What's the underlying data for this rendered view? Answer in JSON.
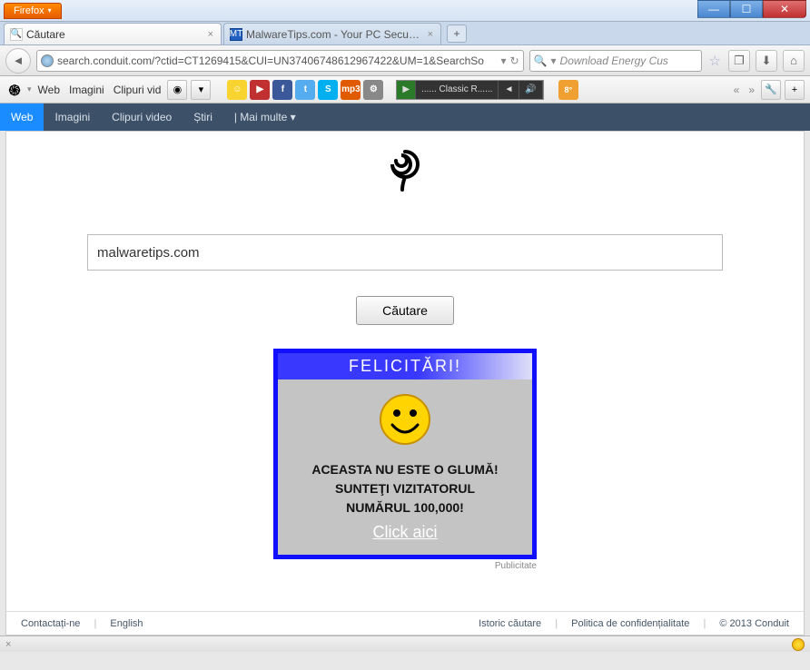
{
  "window": {
    "app_button": "Firefox",
    "controls": {
      "min": "—",
      "max": "☐",
      "close": "✕"
    }
  },
  "tabs": {
    "active": {
      "title": "Căutare",
      "favicon_glyph": "🔍"
    },
    "inactive": {
      "title": "MalwareTips.com - Your PC Security ...",
      "favicon_text": "MT"
    },
    "close_glyph": "×",
    "new_glyph": "+"
  },
  "navbar": {
    "back_glyph": "◄",
    "url": "search.conduit.com/?ctid=CT1269415&CUI=UN37406748612967422&UM=1&SearchSo",
    "reload_glyph": "↻",
    "dropdown_glyph": "▾",
    "search_placeholder": "Download Energy Cus",
    "search_icon_glyph": "🔍",
    "star_glyph": "☆",
    "bookmark_glyph": "❐",
    "download_glyph": "⬇",
    "home_glyph": "⌂"
  },
  "conduit_bar": {
    "spiral_glyph": "֍",
    "items": [
      "Web",
      "Imagini",
      "Clipuri vid"
    ],
    "more_glyph": "▾",
    "toggle_glyph": "◉",
    "icons": [
      {
        "name": "smiley-icon",
        "bg": "#f9d431",
        "txt": "☺"
      },
      {
        "name": "playvids-icon",
        "bg": "#c03030",
        "txt": "▶"
      },
      {
        "name": "facebook-icon",
        "bg": "#3b5998",
        "txt": "f"
      },
      {
        "name": "twitter-icon",
        "bg": "#55acee",
        "txt": "t"
      },
      {
        "name": "skype-icon",
        "bg": "#00aff0",
        "txt": "S"
      },
      {
        "name": "mp3-icon",
        "bg": "#e05a00",
        "txt": "mp3"
      },
      {
        "name": "tool-icon",
        "bg": "#888",
        "txt": "⚙"
      }
    ],
    "player": {
      "play": "▶",
      "label": "...... Classic R......",
      "prev": "◄",
      "vol": "🔊"
    },
    "weather_glyph": "☁",
    "weather_temp": "8°",
    "chev_left": "«",
    "chev_right": "»",
    "wrench_glyph": "🔧",
    "plus_glyph": "+"
  },
  "subnav": {
    "items": [
      "Web",
      "Imagini",
      "Clipuri video",
      "Știri",
      "| Mai multe ▾"
    ],
    "active_index": 0
  },
  "page": {
    "search_value": "malwaretips.com",
    "search_button": "Căutare"
  },
  "ad": {
    "heading": "FELICITĂRI!",
    "line1": "ACEASTA NU ESTE O GLUMĂ!",
    "line2": "SUNTEŢI VIZITATORUL",
    "line3": "NUMĂRUL 100,000!",
    "link": "Click aici",
    "label": "Publicitate"
  },
  "footer": {
    "left": [
      "Contactați-ne",
      "English"
    ],
    "right": [
      "Istoric căutare",
      "Politica de confidențialitate",
      "© 2013 Conduit"
    ]
  },
  "statusbar": {
    "close": "×"
  }
}
